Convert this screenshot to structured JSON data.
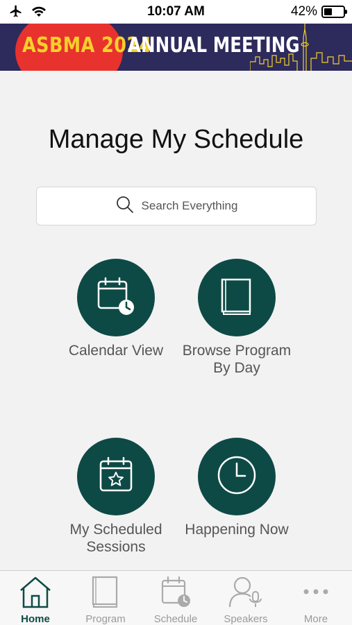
{
  "status": {
    "time": "10:07 AM",
    "battery_percent": "42%",
    "battery_level": 0.42,
    "icons": [
      "airplane-icon",
      "wifi-icon",
      "battery-icon"
    ]
  },
  "banner": {
    "line1": "ASBMA 2024",
    "line2": "ANNUAL MEETING",
    "colors": {
      "background": "#2d2a5c",
      "accent_red": "#e8322e",
      "accent_yellow": "#f5d02b"
    }
  },
  "page": {
    "title": "Manage My Schedule"
  },
  "search": {
    "placeholder": "Search Everything",
    "icon": "search-icon"
  },
  "tiles": [
    {
      "label": "Calendar View",
      "icon": "calendar-clock-icon"
    },
    {
      "label": "Browse Program By Day",
      "icon": "book-icon"
    },
    {
      "label": "My Scheduled Sessions",
      "icon": "calendar-star-icon"
    },
    {
      "label": "Happening Now",
      "icon": "clock-icon"
    }
  ],
  "tabbar": {
    "active": "Home",
    "items": [
      {
        "label": "Home",
        "icon": "home-icon"
      },
      {
        "label": "Program",
        "icon": "book-icon"
      },
      {
        "label": "Schedule",
        "icon": "calendar-clock-icon"
      },
      {
        "label": "Speakers",
        "icon": "speaker-icon"
      },
      {
        "label": "More",
        "icon": "more-dots-icon"
      }
    ]
  },
  "colors": {
    "primary": "#0e4a45",
    "background": "#f2f2f2",
    "inactive_tab": "#9a9a9a"
  }
}
